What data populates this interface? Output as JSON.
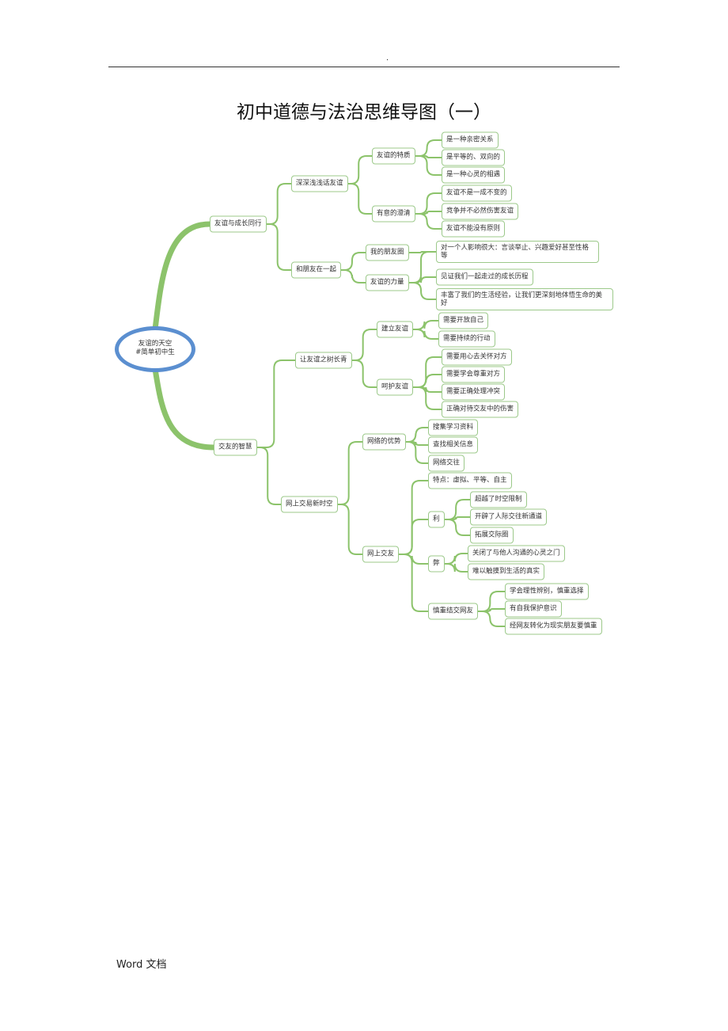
{
  "header": {
    "mark": "."
  },
  "title": "初中道德与法治思维导图（一）",
  "footer": "Word  文档",
  "colors": {
    "branch": "#8cc36b",
    "node_border": "#9cc98a",
    "root_ring": "#5b8fd0"
  },
  "mindmap": {
    "root": {
      "line1": "友谊的天空",
      "line2": "#简单初中生"
    },
    "nodes": {
      "a": "友谊与成长同行",
      "b": "交友的智慧",
      "a1": "深深浅浅话友谊",
      "a2": "和朋友在一起",
      "b1": "让友谊之树长青",
      "b2": "网上交易新时空",
      "a11": "友谊的特质",
      "a12": "有意的澄清",
      "a21": "我的朋友圈",
      "a22": "友谊的力量",
      "b11": "建立友谊",
      "b12": "呵护友谊",
      "b21": "网络的优势",
      "b22": "网上交友",
      "a111": "是一种亲密关系",
      "a112": "是平等的、双向的",
      "a113": "是一种心灵的相遇",
      "a121": "友谊不是一成不变的",
      "a122": "竞争并不必然伤害友谊",
      "a123": "友谊不能没有原则",
      "a2x1": "对一个人影响很大：言谈举止、兴趣爱好甚至性格等",
      "a2x2": "见证我们一起走过的成长历程",
      "a2x3": "丰富了我们的生活经验，让我们更深刻地体悟生命的美好",
      "b111": "需要开放自己",
      "b112": "需要持续的行动",
      "b121": "需要用心去关怀对方",
      "b122": "需要学会尊重对方",
      "b123": "需要正确处理冲突",
      "b124": "正确对待交友中的伤害",
      "b211": "搜集学习资料",
      "b212": "查找相关信息",
      "b213": "网络交往",
      "b221": "特点：虚拟、平等、自主",
      "b222": "利",
      "b223": "弊",
      "b224": "慎重结交网友",
      "b2221": "超越了时空限制",
      "b2222": "开辟了人际交往新通道",
      "b2223": "拓展交际圈",
      "b2231": "关闭了与他人沟通的心灵之门",
      "b2232": "难以触摸到生活的真实",
      "b2241": "学会理性辨别，慎重选择",
      "b2242": "有自我保护意识",
      "b2243": "经网友转化为现实朋友要慎重"
    }
  }
}
